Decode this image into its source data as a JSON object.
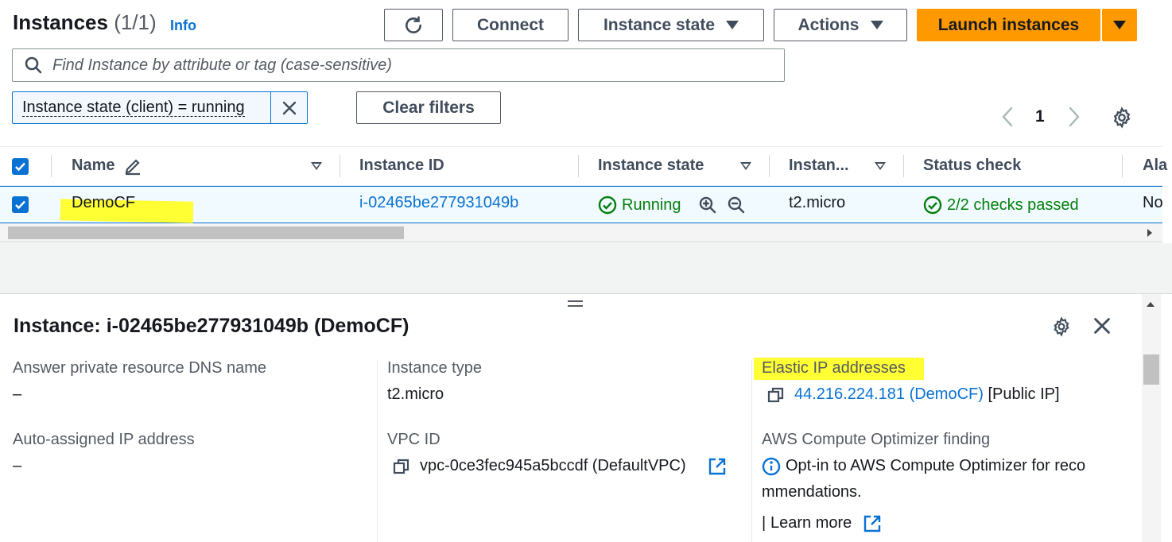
{
  "header": {
    "title": "Instances",
    "count": "(1/1)",
    "info": "Info",
    "connect_label": "Connect",
    "instance_state_label": "Instance state",
    "actions_label": "Actions",
    "launch_label": "Launch instances"
  },
  "search": {
    "placeholder": "Find Instance by attribute or tag (case-sensitive)"
  },
  "filter": {
    "token": "Instance state (client) = running",
    "clear_label": "Clear filters"
  },
  "pagination": {
    "current_page": "1"
  },
  "table": {
    "columns": [
      "Name",
      "Instance ID",
      "Instance state",
      "Instan...",
      "Status check",
      "Ala"
    ],
    "row": {
      "name": "DemoCF",
      "instance_id": "i-02465be277931049b",
      "state": "Running",
      "type": "t2.micro",
      "status_check": "2/2 checks passed",
      "alarm": "No"
    }
  },
  "detail": {
    "title": "Instance: i-02465be277931049b (DemoCF)",
    "fields": {
      "dns_label": "Answer private resource DNS name",
      "dns_value": "–",
      "auto_ip_label": "Auto-assigned IP address",
      "auto_ip_value": "–",
      "instance_type_label": "Instance type",
      "instance_type_value": "t2.micro",
      "vpc_label": "VPC ID",
      "vpc_value": "vpc-0ce3fec945a5bccdf (DefaultVPC)",
      "elastic_ip_label": "Elastic IP addresses",
      "elastic_ip_value": "44.216.224.181 (DemoCF)",
      "elastic_ip_suffix": "[Public IP]",
      "optimizer_label": "AWS Compute Optimizer finding",
      "optimizer_link_line1": "Opt-in to AWS Compute Optimizer for reco",
      "optimizer_link_line2": "mmendations.",
      "learn_more_sep": "|",
      "learn_more": "Learn more"
    }
  },
  "colors": {
    "primary": "#ff9900",
    "link": "#0972d3",
    "success": "#037f0c",
    "highlight": "#ffff33"
  }
}
